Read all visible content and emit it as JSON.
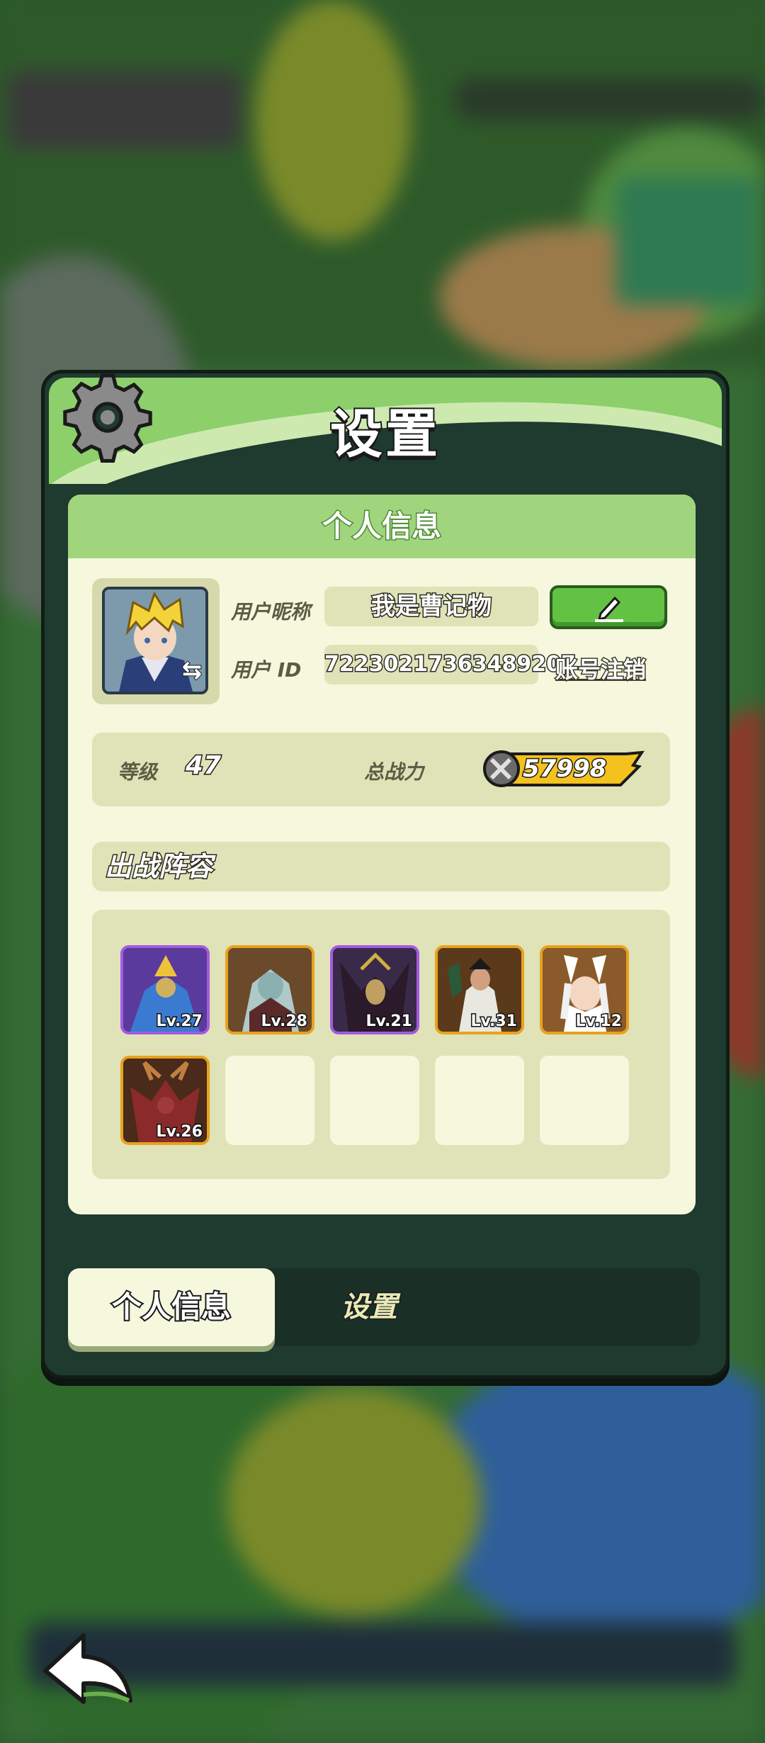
{
  "dialog": {
    "title": "设置"
  },
  "panel": {
    "header": "个人信息"
  },
  "profile": {
    "nickname_label": "用户昵称",
    "nickname": "我是曹记物",
    "id_label": "用户 ID",
    "id_value": "72230217363489207",
    "logout_label": "账号注销"
  },
  "stats": {
    "level_label": "等级",
    "level": "47",
    "power_label": "总战力",
    "power": "57998"
  },
  "lineup": {
    "title": "出战阵容",
    "heroes": [
      {
        "level": "Lv.27",
        "rarity": "purple"
      },
      {
        "level": "Lv.28",
        "rarity": "orange"
      },
      {
        "level": "Lv.21",
        "rarity": "purple"
      },
      {
        "level": "Lv.31",
        "rarity": "orange"
      },
      {
        "level": "Lv.12",
        "rarity": "orange"
      },
      {
        "level": "Lv.26",
        "rarity": "orange"
      }
    ],
    "empty_slots": 4
  },
  "tabs": {
    "info": "个人信息",
    "settings": "设置"
  },
  "colors": {
    "purple_frame": "#a35ae0",
    "orange_frame": "#e8a21c",
    "accent_green": "#63c244"
  }
}
